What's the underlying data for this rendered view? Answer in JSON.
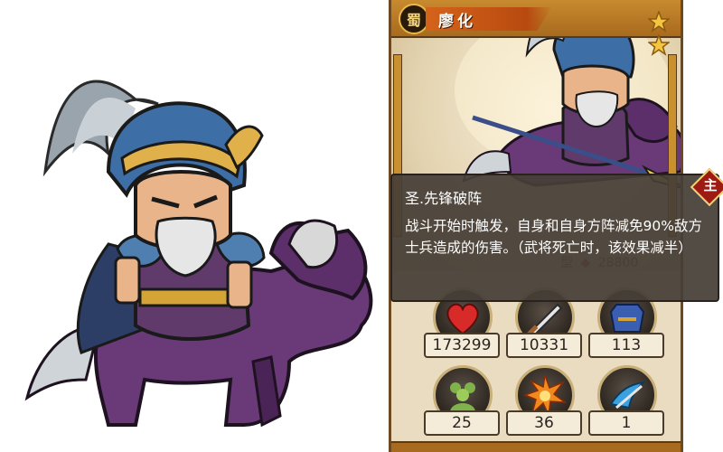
{
  "hero": {
    "name": "廖化",
    "faction": "蜀",
    "stars": 2
  },
  "skill": {
    "name": "圣.先锋破阵",
    "description": "战斗开始时触发，自身和自身方阵减免90%敌方士兵造成的伤害。（武将死亡时，该效果减半）",
    "badge": "主"
  },
  "hidden_stat": {
    "label": "型",
    "value": "28800"
  },
  "stats": [
    {
      "icon": "heart-icon",
      "value": "173299"
    },
    {
      "icon": "sword-icon",
      "value": "10331"
    },
    {
      "icon": "armor-icon",
      "value": "113"
    },
    {
      "icon": "troops-icon",
      "value": "25"
    },
    {
      "icon": "explosion-icon",
      "value": "36"
    },
    {
      "icon": "speed-icon",
      "value": "1"
    }
  ],
  "colors": {
    "card_bg": "#e9dcc1",
    "frame": "#c88a2e",
    "name_ribbon": "#d4631a",
    "tooltip_bg": "#463e37",
    "badge_red": "#9e1b14"
  }
}
